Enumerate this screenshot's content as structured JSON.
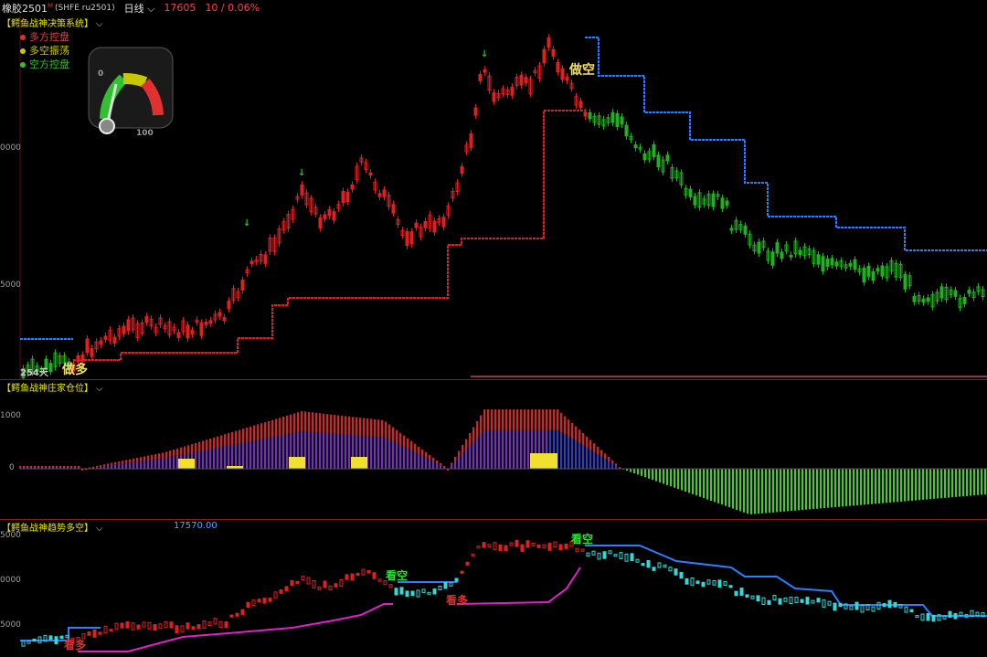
{
  "header": {
    "symbol": "橡胶2501",
    "symbol_mark": "M",
    "code": "(SHFE ru2501)",
    "period": "日线",
    "price": "17605",
    "change": "10 / 0.06%"
  },
  "panel1": {
    "title": "【鳄鱼战神决策系统】",
    "legend": [
      {
        "label": "多方控盘",
        "color": "#e03030"
      },
      {
        "label": "多空振荡",
        "color": "#c8c800"
      },
      {
        "label": "空方控盘",
        "color": "#30c030"
      }
    ],
    "gauge_min": "0",
    "gauge_max": "100",
    "axis": [
      "0000",
      "5000"
    ],
    "days_label": "254天",
    "signal_long": "做多",
    "signal_short": "做空"
  },
  "panel2": {
    "title": "【鳄鱼战神庄家仓位】",
    "axis": [
      "1000",
      "0"
    ]
  },
  "panel3": {
    "title": "【鳄鱼战神趋势多空】",
    "value": "17570.00",
    "axis": [
      "5000",
      "0000",
      "5000"
    ],
    "signal_bear_1": "看空",
    "signal_bear_2": "看空",
    "signal_bull_1": "看多",
    "signal_bull_2": "看多"
  },
  "colors": {
    "bull": "#e02020",
    "bear": "#20b020",
    "stop_blue": "#2a7fff",
    "purple": "#7a2cc8",
    "cyan": "#30d8d8",
    "magenta": "#e020c8",
    "signal_yellow": "#f0e060"
  }
}
